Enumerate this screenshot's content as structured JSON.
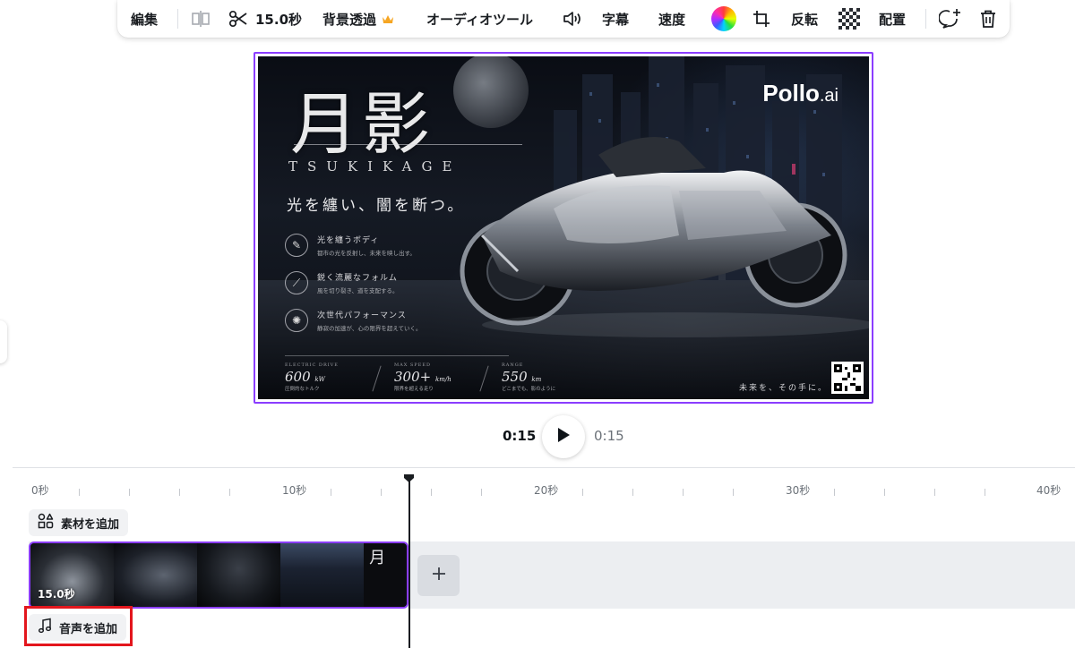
{
  "toolbar": {
    "edit_label": "編集",
    "duration_label": "15.0秒",
    "bg_remove_label": "背景透過",
    "audio_tools_label": "オーディオツール",
    "captions_label": "字幕",
    "speed_label": "速度",
    "flip_label": "反転",
    "arrange_label": "配置"
  },
  "poster": {
    "title": "月影",
    "romaji": "TSUKIKAGE",
    "tagline": "光を纏い、闇を断つ。",
    "brand": "Pollo",
    "brand_suffix": ".ai",
    "features": [
      {
        "title": "光を纏うボディ",
        "desc": "都市の光を反射し、未来を映し出す。"
      },
      {
        "title": "鋭く流麗なフォルム",
        "desc": "風を切り裂き、道を支配する。"
      },
      {
        "title": "次世代パフォーマンス",
        "desc": "静寂の加速が、心の限界を超えていく。"
      }
    ],
    "specs": [
      {
        "key": "ELECTRIC DRIVE",
        "value": "600",
        "unit": "kW",
        "desc": "圧倒的なトルク"
      },
      {
        "key": "MAX SPEED",
        "value": "300+",
        "unit": "km/h",
        "desc": "限界を超える走り"
      },
      {
        "key": "RANGE",
        "value": "550",
        "unit": "km",
        "desc": "どこまでも、影のように"
      }
    ],
    "footer": "未来を、その手に。"
  },
  "playback": {
    "current_time": "0:15",
    "total_time": "0:15"
  },
  "timeline": {
    "ruler_labels": [
      "0秒",
      "10秒",
      "20秒",
      "30秒",
      "40秒"
    ],
    "add_element_label": "素材を追加",
    "clip_duration": "15.0秒",
    "add_audio_label": "音声を追加",
    "clip_title_glyph": "月"
  },
  "colors": {
    "selection_accent": "#8b3dff",
    "highlight": "#e3161d",
    "premium_crown": "#f6a623"
  }
}
